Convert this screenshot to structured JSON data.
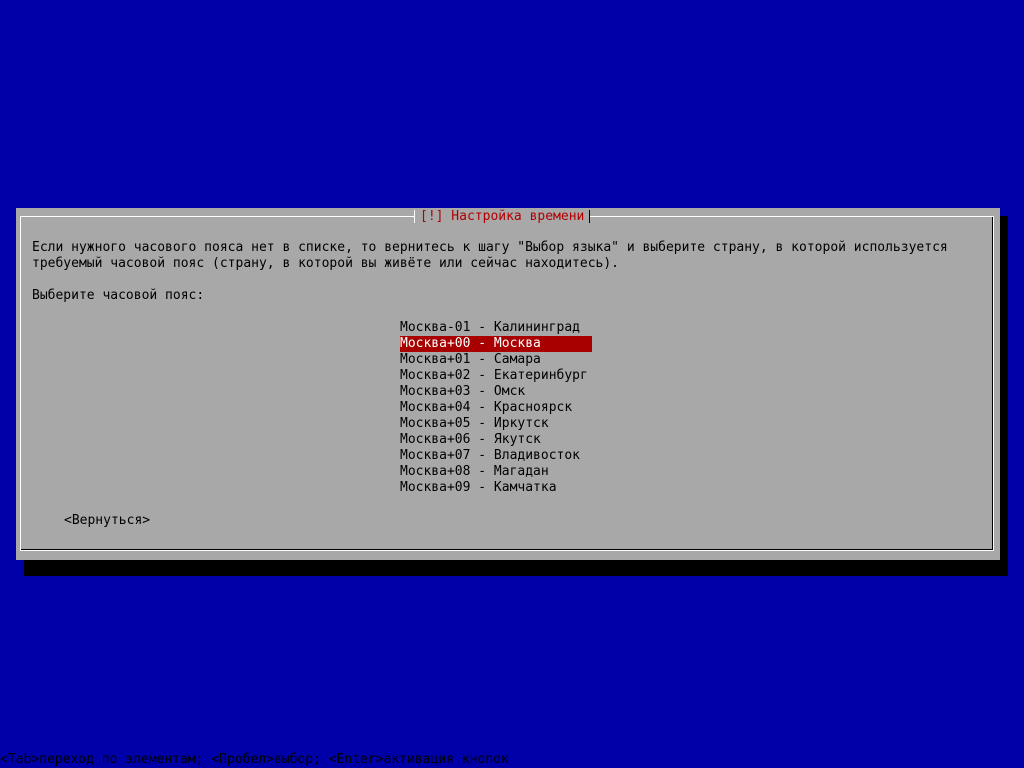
{
  "dialog": {
    "title": "[!] Настройка времени",
    "description_line1": "Если нужного часового пояса нет в списке, то вернитесь к шагу \"Выбор языка\" и выберите страну, в которой используется",
    "description_line2": "требуемый часовой пояс (страну, в которой вы живёте или сейчас находитесь).",
    "prompt": "Выберите часовой пояс:",
    "timezones": [
      "Москва-01 - Калининград",
      "Москва+00 - Москва",
      "Москва+01 - Самара",
      "Москва+02 - Екатеринбург",
      "Москва+03 - Омск",
      "Москва+04 - Красноярск",
      "Москва+05 - Иркутск",
      "Москва+06 - Якутск",
      "Москва+07 - Владивосток",
      "Москва+08 - Магадан",
      "Москва+09 - Камчатка"
    ],
    "selected_timezone": "Москва+00 - Москва",
    "back_label": "<Вернуться>"
  },
  "status_bar": {
    "text": "<Tab>переход по элементам; <Пробел>выбор; <Enter>активация кнопок"
  },
  "colors": {
    "background": "#0000a8",
    "dialog": "#a8a8a8",
    "title_text": "#b00000",
    "selection": "#a80000"
  }
}
